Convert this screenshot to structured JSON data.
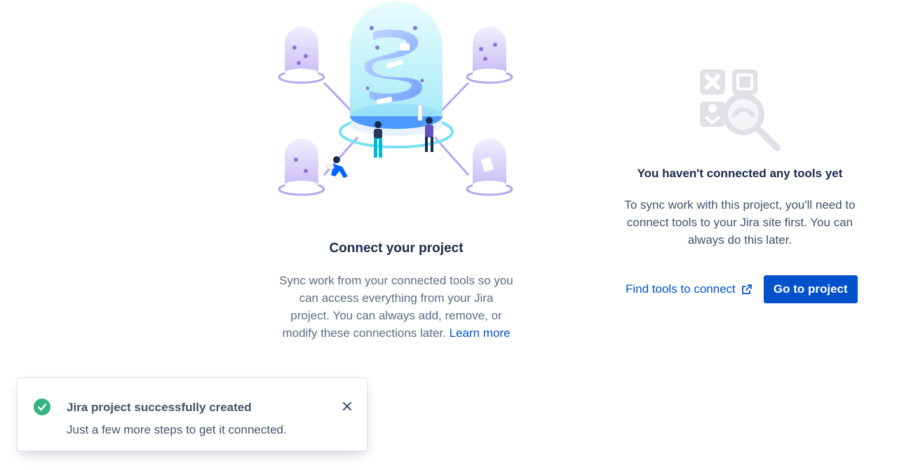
{
  "connect": {
    "title": "Connect your project",
    "description": "Sync work from your connected tools so you can access everything from your Jira project. You can always add, remove, or modify these connections later.",
    "learn_more": "Learn more"
  },
  "empty_state": {
    "title": "You haven't connected any tools yet",
    "description": "To sync work with this project, you'll need to connect tools to your Jira site first. You can always do this later."
  },
  "actions": {
    "find_tools": "Find tools to connect",
    "go_to_project": "Go to project"
  },
  "toast": {
    "title": "Jira project successfully created",
    "body": "Just a few more steps to get it connected."
  },
  "colors": {
    "primary": "#0052cc",
    "success": "#36b37e",
    "text_heading": "#172b4d",
    "text_subtle": "#42526e"
  },
  "icons": {
    "hero": "connected-tools-illustration",
    "empty": "search-tools-icon",
    "external": "external-link-icon",
    "toast_status": "success-check-icon",
    "toast_close": "close-icon"
  }
}
